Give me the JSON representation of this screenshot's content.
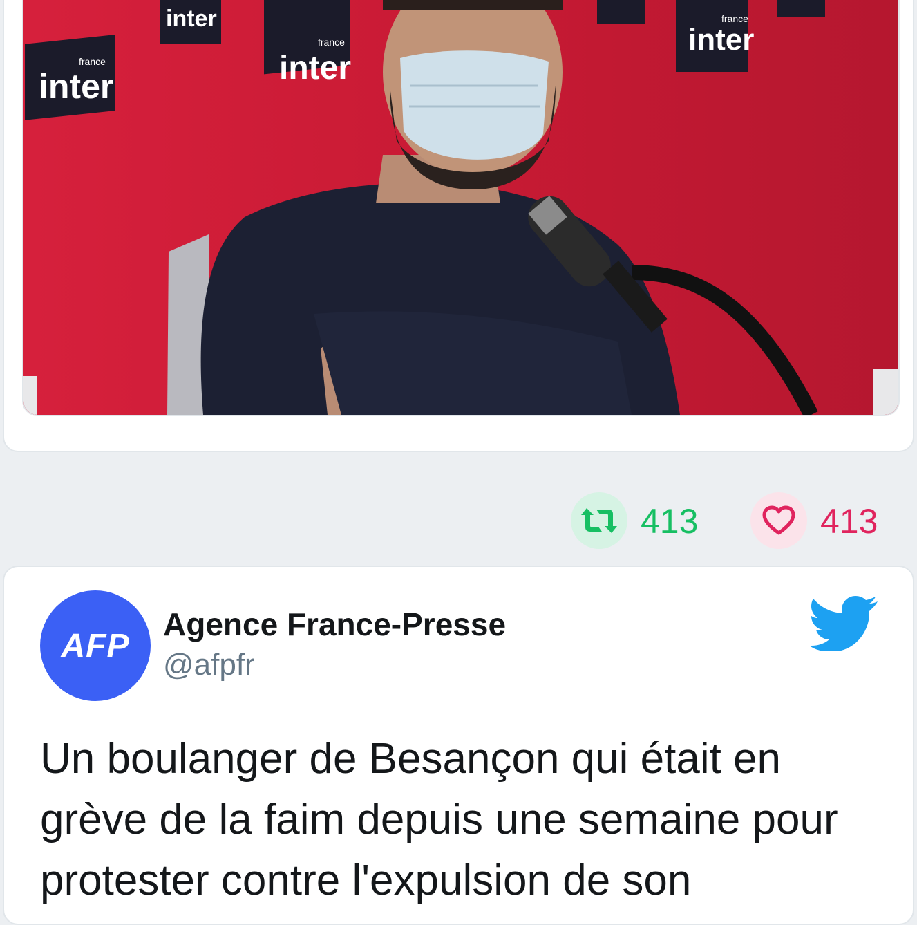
{
  "embed_top": {
    "retweet_count": "413",
    "like_count": "413"
  },
  "embed_tweet": {
    "avatar_text": "AFP",
    "author_name": "Agence France-Presse",
    "author_handle": "@afpfr",
    "text": "Un boulanger de Besançon qui était en grève de la faim depuis une semaine pour protester contre l'expulsion de son"
  },
  "media": {
    "backdrop_logo_text": "inter",
    "backdrop_logo_small": "france"
  },
  "colors": {
    "retweet": "#17bf63",
    "like": "#e0245e",
    "twitter_blue": "#1da1f2",
    "afp_blue": "#3b60f5",
    "backdrop_red": "#c21a33"
  },
  "icons": [
    "retweet-icon",
    "heart-icon",
    "twitter-bird-icon"
  ]
}
